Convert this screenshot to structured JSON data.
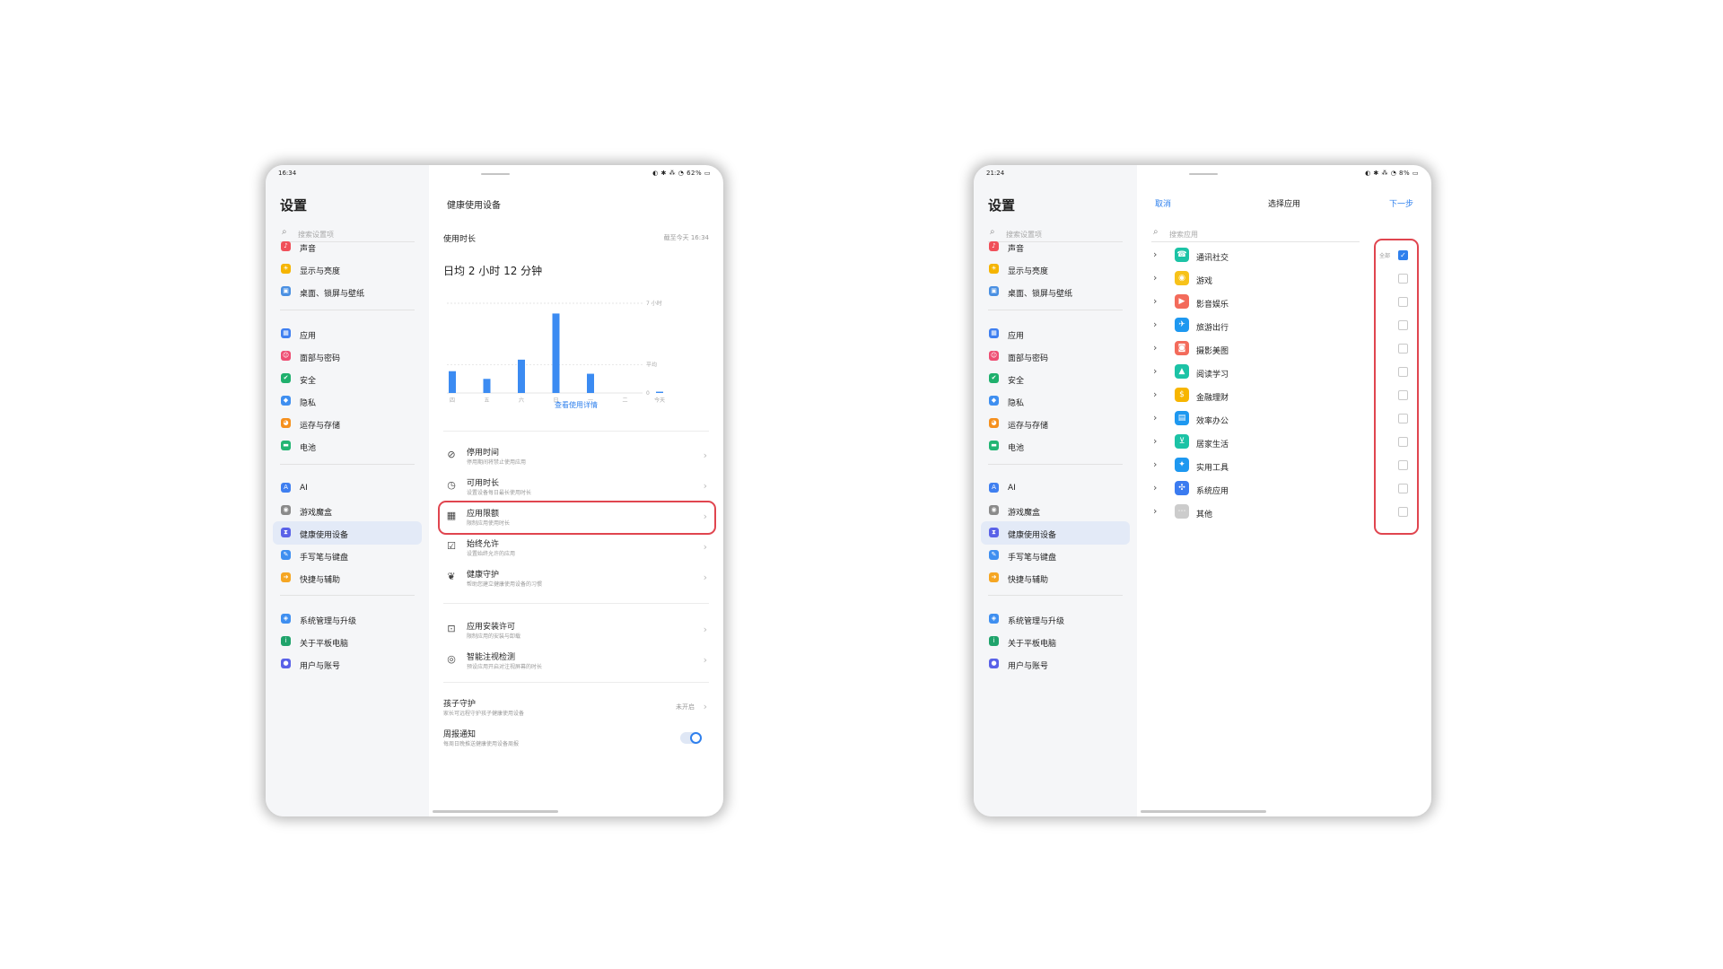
{
  "colors": {
    "accent": "#2f80ed",
    "highlight": "#e0454f",
    "bar": "#3b8bf2",
    "active_bg": "#e3eaf7"
  },
  "sidebar": {
    "title": "设置",
    "search_placeholder": "搜索设置项",
    "items": [
      {
        "label": "声音",
        "icon": "speaker-icon",
        "color": "#f0505a"
      },
      {
        "label": "显示与亮度",
        "icon": "sun-icon",
        "color": "#f5b400"
      },
      {
        "label": "桌面、锁屏与壁纸",
        "icon": "wallpaper-icon",
        "color": "#4a90e2"
      },
      {
        "label": "应用",
        "icon": "apps-grid-icon",
        "color": "#3f7ff0"
      },
      {
        "label": "面部与密码",
        "icon": "face-icon",
        "color": "#ee4e73"
      },
      {
        "label": "安全",
        "icon": "shield-icon",
        "color": "#1fb06d"
      },
      {
        "label": "隐私",
        "icon": "privacy-icon",
        "color": "#3f8ff0"
      },
      {
        "label": "运存与存储",
        "icon": "storage-pie-icon",
        "color": "#f5901e"
      },
      {
        "label": "电池",
        "icon": "battery-icon",
        "color": "#22b573"
      },
      {
        "label": "AI",
        "icon": "ai-icon",
        "color": "#3f7ff0"
      },
      {
        "label": "游戏魔盒",
        "icon": "gamepad-icon",
        "color": "#8a8a8a"
      },
      {
        "label": "健康使用设备",
        "icon": "hourglass-icon",
        "color": "#5a62e8"
      },
      {
        "label": "手写笔与键盘",
        "icon": "stylus-icon",
        "color": "#3f8ff0"
      },
      {
        "label": "快捷与辅助",
        "icon": "shortcut-icon",
        "color": "#f5a623"
      },
      {
        "label": "系统管理与升级",
        "icon": "system-cube-icon",
        "color": "#3f8ff0"
      },
      {
        "label": "关于平板电脑",
        "icon": "info-icon",
        "color": "#1fa36b"
      },
      {
        "label": "用户与账号",
        "icon": "user-icon",
        "color": "#5a62e8"
      }
    ]
  },
  "left": {
    "status": {
      "time": "16:34",
      "icons": "◐ ✱ ⁂ ◔ 62% ▭"
    },
    "title": "健康使用设备",
    "usage_label": "使用时长",
    "deadline": "截至今天 16:34",
    "daily_avg": "日均 2 小时 12 分钟",
    "chart_link": "查看使用详情",
    "rows": [
      {
        "title": "停用时间",
        "subtitle": "停用期间将禁止使用应用",
        "icon": "alarm-off-icon",
        "value": ""
      },
      {
        "title": "可用时长",
        "subtitle": "设置设备每日最长使用时长",
        "icon": "timer-icon",
        "value": ""
      },
      {
        "title": "应用限额",
        "subtitle": "限制应用使用时长",
        "icon": "app-limit-icon",
        "value": ""
      },
      {
        "title": "始终允许",
        "subtitle": "设置始终允许的应用",
        "icon": "always-allow-icon",
        "value": ""
      },
      {
        "title": "健康守护",
        "subtitle": "帮助您建立健康使用设备的习惯",
        "icon": "sprout-icon",
        "value": ""
      },
      {
        "title": "应用安装许可",
        "subtitle": "限制应用的安装与卸载",
        "icon": "install-permit-icon",
        "value": ""
      },
      {
        "title": "智能注视检测",
        "subtitle": "预设应用开启对注视屏幕的时长",
        "icon": "eye-detect-icon",
        "value": ""
      },
      {
        "title": "孩子守护",
        "subtitle": "家长可远程守护孩子健康使用设备",
        "icon": "",
        "value": "未开启"
      },
      {
        "title": "周报通知",
        "subtitle": "每周日晚推送健康使用设备周报",
        "icon": "",
        "value": ""
      }
    ]
  },
  "chart_data": {
    "type": "bar",
    "categories": [
      "四",
      "五",
      "六",
      "日",
      "一",
      "二",
      "今天"
    ],
    "values": [
      0.85,
      0.55,
      1.3,
      3.1,
      0.75,
      0,
      0.05
    ],
    "ylim": [
      0,
      3.5
    ],
    "y_tick_labels": [
      {
        "value": 3.5,
        "label": "7 小时"
      },
      {
        "value": 1.1,
        "label": "平均"
      },
      {
        "value": 0,
        "label": "0"
      }
    ],
    "grid": true
  },
  "right": {
    "status": {
      "time": "21:24",
      "icons": "◐ ✱ ⁂ ◔ 8% ▭"
    },
    "cancel": "取消",
    "title": "选择应用",
    "next": "下一步",
    "search_placeholder": "搜索应用",
    "all_label": "全部",
    "categories": [
      {
        "label": "通讯社交",
        "icon": "phone-icon",
        "color": "#1cc3a6",
        "checked": true
      },
      {
        "label": "游戏",
        "icon": "game-icon",
        "color": "#f7c21a",
        "checked": false
      },
      {
        "label": "影音娱乐",
        "icon": "video-icon",
        "color": "#f36b5b",
        "checked": false
      },
      {
        "label": "旅游出行",
        "icon": "plane-icon",
        "color": "#1e98f0",
        "checked": false
      },
      {
        "label": "摄影美图",
        "icon": "camera-icon",
        "color": "#f36b5b",
        "checked": false
      },
      {
        "label": "阅读学习",
        "icon": "graduation-icon",
        "color": "#1cc3a6",
        "checked": false
      },
      {
        "label": "金融理财",
        "icon": "finance-icon",
        "color": "#f7b500",
        "checked": false
      },
      {
        "label": "效率办公",
        "icon": "briefcase-icon",
        "color": "#1e98f0",
        "checked": false
      },
      {
        "label": "居家生活",
        "icon": "cart-icon",
        "color": "#1cc3a6",
        "checked": false
      },
      {
        "label": "实用工具",
        "icon": "tools-icon",
        "color": "#1e98f0",
        "checked": false
      },
      {
        "label": "系统应用",
        "icon": "system-apps-icon",
        "color": "#3b7bf0",
        "checked": false
      },
      {
        "label": "其他",
        "icon": "more-icon",
        "color": "#cccccc",
        "checked": false
      }
    ]
  }
}
